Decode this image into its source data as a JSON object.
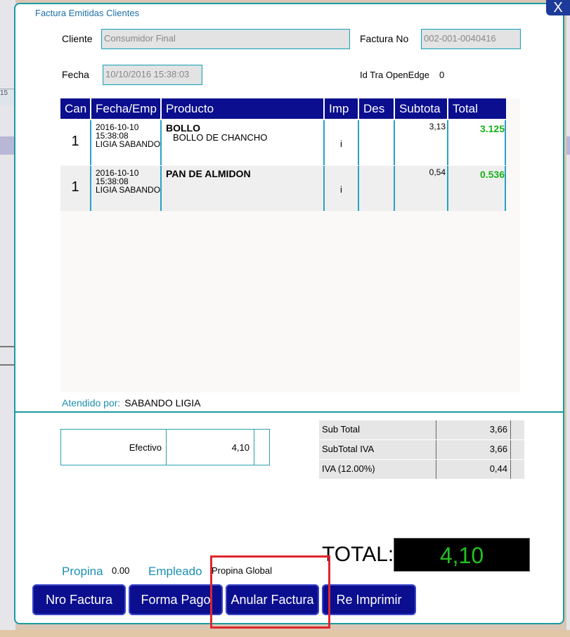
{
  "window": {
    "title": "Factura Emitidas Clientes",
    "close_label": "X"
  },
  "background": {
    "left_tab_label": "15"
  },
  "header": {
    "cliente_label": "Cliente",
    "cliente_value": "Consumidor Final",
    "factura_no_label": "Factura No",
    "factura_no_value": "002-001-0040416",
    "fecha_label": "Fecha",
    "fecha_value": "10/10/2016 15:38:03",
    "id_tra_label": "Id Tra OpenEdge",
    "id_tra_value": "0"
  },
  "table": {
    "columns": [
      "Can",
      "Fecha/Emp",
      "Producto",
      "Imp",
      "Des",
      "Subtota",
      "Total"
    ],
    "rows": [
      {
        "can": "1",
        "fecha": "2016-10-10",
        "hora": "15:38:08",
        "emp": "LIGIA SABANDO",
        "producto": "BOLLO",
        "detalle": "BOLLO DE CHANCHO",
        "imp": "i",
        "des": "",
        "subtotal": "3,13",
        "total": "3.125"
      },
      {
        "can": "1",
        "fecha": "2016-10-10",
        "hora": "15:38:08",
        "emp": "LIGIA SABANDO",
        "producto": "PAN DE ALMIDON",
        "detalle": "",
        "imp": "i",
        "des": "",
        "subtotal": "0,54",
        "total": "0.536"
      }
    ]
  },
  "attended": {
    "label": "Atendido por:",
    "value": "SABANDO LIGIA"
  },
  "payment": {
    "method": "Efectivo",
    "amount": "4,10"
  },
  "summary": [
    {
      "label": "Sub Total",
      "value": "3,66"
    },
    {
      "label": "SubTotal IVA",
      "value": "3,66"
    },
    {
      "label": "IVA (12.00%)",
      "value": "0,44"
    }
  ],
  "total": {
    "label": "TOTAL:",
    "value": "4,10"
  },
  "footer": {
    "propina_label": "Propina",
    "propina_value": "0.00",
    "empleado_label": "Empleado",
    "propina_global": "Propina Global"
  },
  "buttons": {
    "nro_factura": "Nro Factura",
    "forma_pago": "Forma Pago",
    "anular_factura": "Anular Factura",
    "re_imprimir": "Re Imprimir"
  },
  "colors": {
    "header_bg": "#0b0e8e",
    "accent_teal": "#1c9aa3",
    "total_green": "#18b018",
    "highlight_red": "#e0262d"
  }
}
